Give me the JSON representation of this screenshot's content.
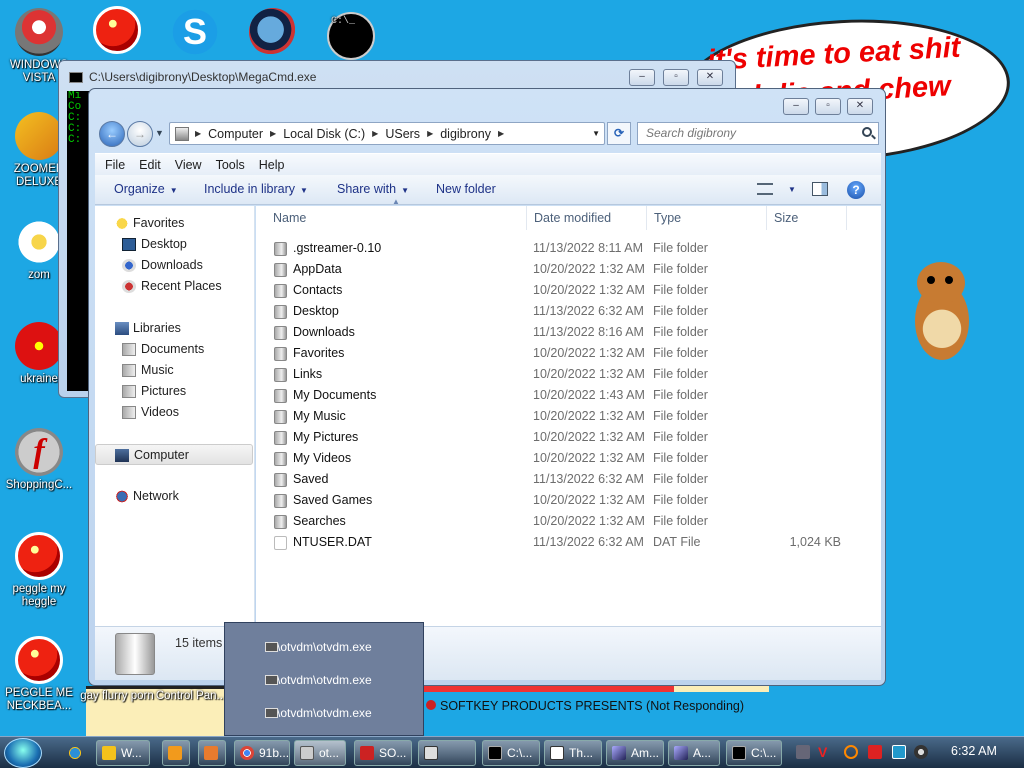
{
  "desktop": {
    "icons": [
      {
        "label": "WINDOWS VISTA"
      },
      {
        "label": "ZOOMER DELUXE"
      },
      {
        "label": "zom"
      },
      {
        "label": "ukraine"
      },
      {
        "label": "ShoppingC..."
      },
      {
        "label": "peggle my heggle"
      },
      {
        "label": "PEGGLE ME NECKBEA..."
      },
      {
        "label": "gay flurry porn"
      },
      {
        "label": "Control Pan..."
      }
    ],
    "bubble_text": "it's time to eat shit and die and chew"
  },
  "cmd_window": {
    "title": "C:\\Users\\digibrony\\Desktop\\MegaCmd.exe",
    "body_lines": [
      "Mi",
      "Co",
      "",
      "C:",
      "",
      "C:",
      "",
      "C:"
    ]
  },
  "explorer": {
    "address": [
      "Computer",
      "Local Disk (C:)",
      "USers",
      "digibrony"
    ],
    "search_placeholder": "Search digibrony",
    "menu": [
      "File",
      "Edit",
      "View",
      "Tools",
      "Help"
    ],
    "toolbar": {
      "organize": "Organize",
      "include": "Include in library",
      "share": "Share with",
      "new_folder": "New folder"
    },
    "nav": {
      "favorites": "Favorites",
      "desktop": "Desktop",
      "downloads": "Downloads",
      "recent": "Recent Places",
      "libraries": "Libraries",
      "documents": "Documents",
      "music": "Music",
      "pictures": "Pictures",
      "videos": "Videos",
      "computer": "Computer",
      "network": "Network"
    },
    "columns": {
      "name": "Name",
      "date": "Date modified",
      "type": "Type",
      "size": "Size"
    },
    "files": [
      {
        "name": ".gstreamer-0.10",
        "date": "11/13/2022 8:11 AM",
        "type": "File folder",
        "size": ""
      },
      {
        "name": "AppData",
        "date": "10/20/2022 1:32 AM",
        "type": "File folder",
        "size": ""
      },
      {
        "name": "Contacts",
        "date": "10/20/2022 1:32 AM",
        "type": "File folder",
        "size": ""
      },
      {
        "name": "Desktop",
        "date": "11/13/2022 6:32 AM",
        "type": "File folder",
        "size": ""
      },
      {
        "name": "Downloads",
        "date": "11/13/2022 8:16 AM",
        "type": "File folder",
        "size": ""
      },
      {
        "name": "Favorites",
        "date": "10/20/2022 1:32 AM",
        "type": "File folder",
        "size": ""
      },
      {
        "name": "Links",
        "date": "10/20/2022 1:32 AM",
        "type": "File folder",
        "size": ""
      },
      {
        "name": "My Documents",
        "date": "10/20/2022 1:43 AM",
        "type": "File folder",
        "size": ""
      },
      {
        "name": "My Music",
        "date": "10/20/2022 1:32 AM",
        "type": "File folder",
        "size": ""
      },
      {
        "name": "My Pictures",
        "date": "10/20/2022 1:32 AM",
        "type": "File folder",
        "size": ""
      },
      {
        "name": "My Videos",
        "date": "10/20/2022 1:32 AM",
        "type": "File folder",
        "size": ""
      },
      {
        "name": "Saved",
        "date": "11/13/2022 6:32 AM",
        "type": "File folder",
        "size": ""
      },
      {
        "name": "Saved Games",
        "date": "10/20/2022 1:32 AM",
        "type": "File folder",
        "size": ""
      },
      {
        "name": "Searches",
        "date": "10/20/2022 1:32 AM",
        "type": "File folder",
        "size": ""
      },
      {
        "name": "NTUSER.DAT",
        "date": "11/13/2022 6:32 AM",
        "type": "DAT File",
        "size": "1,024 KB"
      }
    ],
    "item_count": "15 items"
  },
  "jumplist": [
    "C:\\otvdm\\otvdm.exe",
    "C:\\otvdm\\otvdm.exe",
    "C:\\otvdm\\otvdm.exe"
  ],
  "background_window_text": "SOFTKEY PRODUCTS PRESENTS (Not Responding)",
  "taskbar": {
    "tasks": [
      "W...",
      "",
      "",
      "91b...",
      "ot...",
      "SO...",
      "",
      "C:\\...",
      "Th...",
      "Am...",
      "A...",
      "C:\\..."
    ],
    "clock": "6:32 AM"
  }
}
